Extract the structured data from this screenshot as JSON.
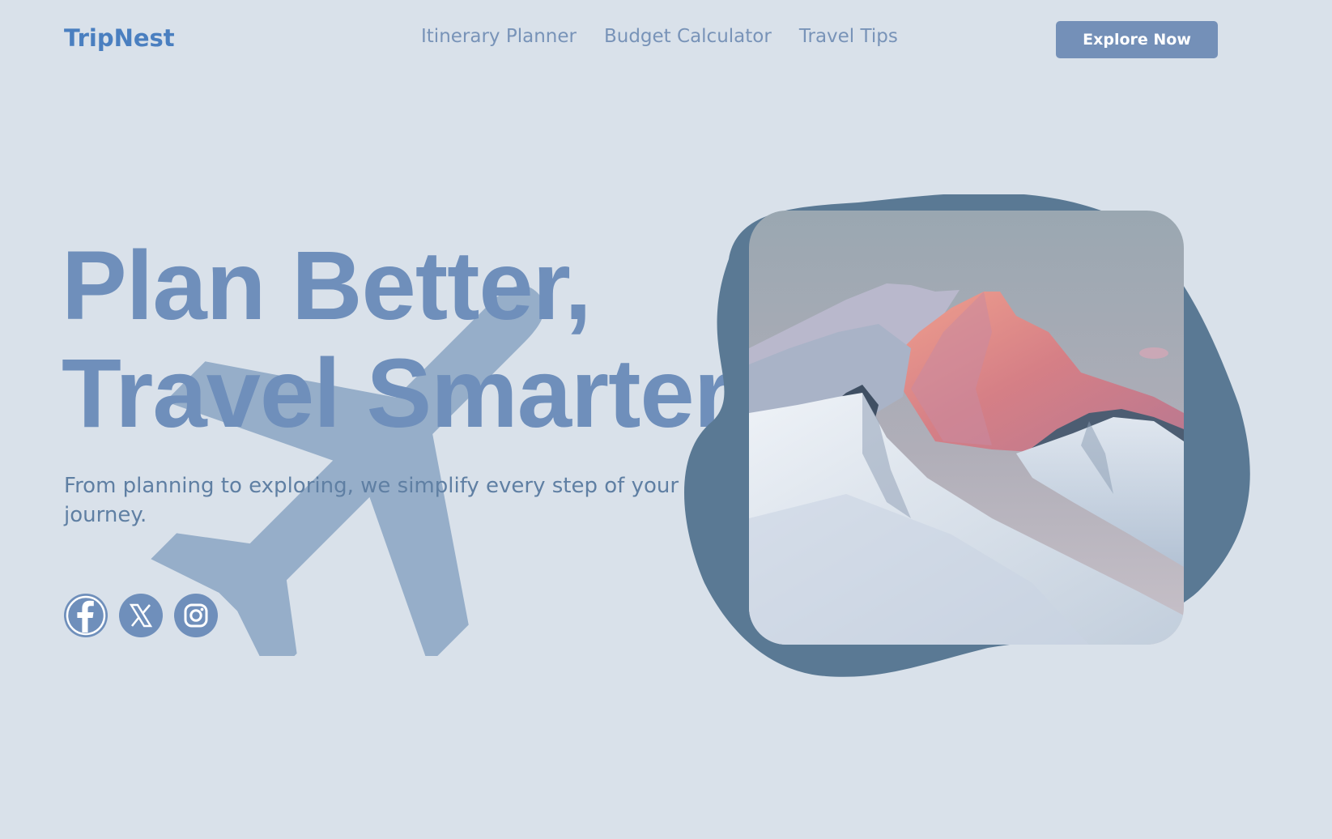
{
  "header": {
    "logo": "TripNest",
    "nav": [
      {
        "label": "Itinerary Planner"
      },
      {
        "label": "Budget Calculator"
      },
      {
        "label": "Travel Tips"
      }
    ],
    "cta_label": "Explore Now"
  },
  "hero": {
    "headline_line1": "Plan Better,",
    "headline_line2": "Travel Smarter",
    "subtitle": "From planning to exploring, we simplify every step of your journey.",
    "socials": [
      {
        "name": "facebook-icon"
      },
      {
        "name": "x-icon"
      },
      {
        "name": "instagram-icon"
      }
    ],
    "decor_icon": "airplane-icon",
    "image": "snowy-mountain-peak-at-sunrise"
  },
  "colors": {
    "background": "#d9e1ea",
    "brand": "#4a7fc0",
    "accent": "#7490b8",
    "blob": "#5a7994",
    "plane": "#96aec9"
  }
}
